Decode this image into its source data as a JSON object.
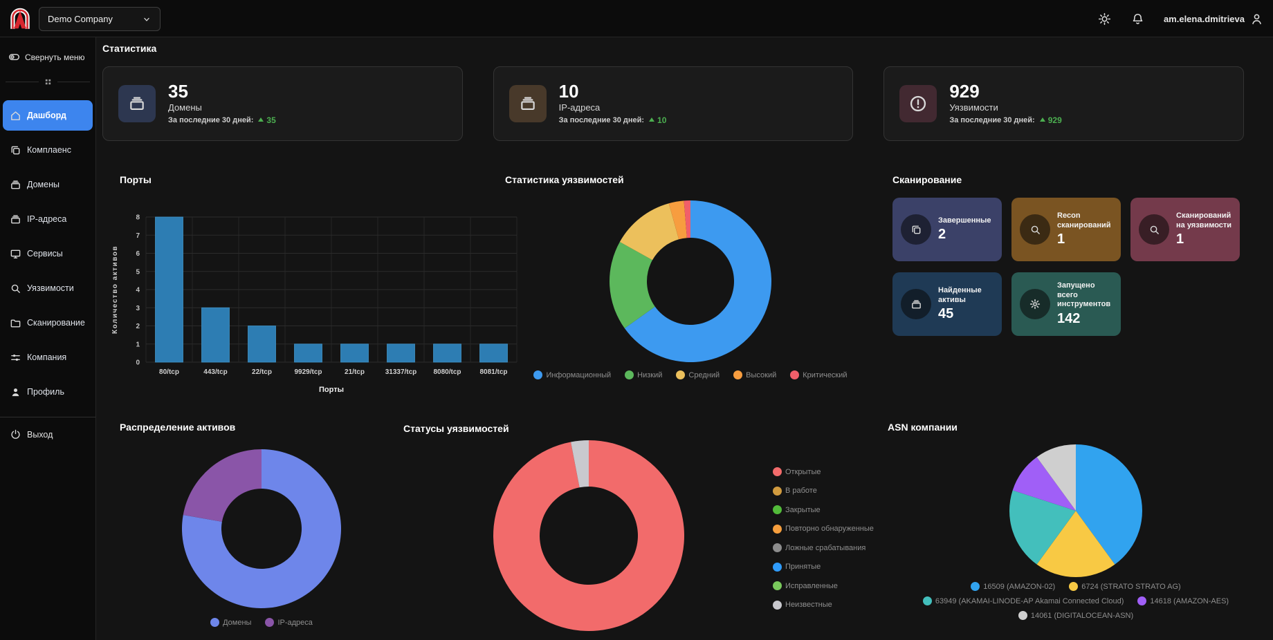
{
  "topbar": {
    "company": "Demo Company",
    "username": "am.elena.dmitrieva"
  },
  "sidebar": {
    "collapse": "Свернуть меню",
    "items": [
      {
        "label": "Дашборд",
        "icon": "home"
      },
      {
        "label": "Комплаенс",
        "icon": "copy"
      },
      {
        "label": "Домены",
        "icon": "archive"
      },
      {
        "label": "IP-адреса",
        "icon": "archive"
      },
      {
        "label": "Сервисы",
        "icon": "monitor"
      },
      {
        "label": "Уязвимости",
        "icon": "search"
      },
      {
        "label": "Сканирование",
        "icon": "folder"
      },
      {
        "label": "Компания",
        "icon": "sliders"
      },
      {
        "label": "Профиль",
        "icon": "user"
      }
    ],
    "logout": "Выход"
  },
  "stats": {
    "title": "Статистика",
    "period_label": "За последние 30 дней:",
    "cards": [
      {
        "value": "35",
        "label": "Домены",
        "delta": "35",
        "icon": "archive",
        "icon_bg": "#2d3750"
      },
      {
        "value": "10",
        "label": "IP-адреса",
        "delta": "10",
        "icon": "archive",
        "icon_bg": "#48392a"
      },
      {
        "value": "929",
        "label": "Уязвимости",
        "delta": "929",
        "icon": "alert",
        "icon_bg": "#422931"
      }
    ]
  },
  "scanning": {
    "title": "Сканирование",
    "cards": [
      {
        "label": "Завершенные",
        "value": "2",
        "bg": "#3b4168",
        "icon": "copy"
      },
      {
        "label": "Recon сканирований",
        "value": "1",
        "bg": "#7a5422",
        "icon": "search"
      },
      {
        "label": "Сканирований на уязвимости",
        "value": "1",
        "bg": "#743a4b",
        "icon": "search"
      },
      {
        "label": "Найденные активы",
        "value": "45",
        "bg": "#1f3a55",
        "icon": "archive"
      },
      {
        "label": "Запущено всего инструментов",
        "value": "142",
        "bg": "#2a5a53",
        "icon": "gear"
      }
    ]
  },
  "colors": {
    "accent": "#3d85ee",
    "trend_green": "#4caf50"
  },
  "chart_data": [
    {
      "type": "bar",
      "title": "Порты",
      "categories": [
        "80/tcp",
        "443/tcp",
        "22/tcp",
        "9929/tcp",
        "21/tcp",
        "31337/tcp",
        "8080/tcp",
        "8081/tcp"
      ],
      "values": [
        8,
        3,
        2,
        1,
        1,
        1,
        1,
        1
      ],
      "xlabel": "Порты",
      "ylabel": "Количество активов",
      "ylim": [
        0,
        8
      ],
      "grid": true,
      "bar_color": "#2d7db3"
    },
    {
      "type": "donut",
      "title": "Статистика уязвимостей",
      "labels": [
        "Информационный",
        "Низкий",
        "Средний",
        "Высокий",
        "Критический"
      ],
      "values": [
        605,
        167,
        117,
        28,
        12
      ],
      "colors": [
        "#3d9af0",
        "#5cb85c",
        "#ecc05c",
        "#f79d3f",
        "#f15f6a"
      ],
      "legend_position": "bottom"
    },
    {
      "type": "donut",
      "title": "Распределение активов",
      "labels": [
        "Домены",
        "IP-адреса"
      ],
      "values": [
        35,
        10
      ],
      "colors": [
        "#6e86ea",
        "#8a55a8"
      ],
      "legend_position": "bottom"
    },
    {
      "type": "donut",
      "title": "Статусы уязвимостей",
      "labels": [
        "Открытые",
        "В работе",
        "Закрытые",
        "Повторно обнаруженные",
        "Ложные срабатывания",
        "Принятые",
        "Исправленные",
        "Неизвестные"
      ],
      "values": [
        901,
        0,
        0,
        0,
        0,
        0,
        0,
        28
      ],
      "colors": [
        "#f26b6b",
        "#d19b3f",
        "#52bb3a",
        "#f69e3d",
        "#8d8d8d",
        "#2f9bfa",
        "#79c95c",
        "#c9c9ce"
      ],
      "legend_position": "right"
    },
    {
      "type": "pie",
      "title": "ASN компании",
      "labels": [
        "16509 (AMAZON-02)",
        "6724 (STRATO STRATO AG)",
        "63949 (AKAMAI-LINODE-AP Akamai Connected Cloud)",
        "14618 (AMAZON-AES)",
        "14061 (DIGITALOCEAN-ASN)"
      ],
      "values": [
        4,
        2,
        2,
        1,
        1
      ],
      "colors": [
        "#31a3ef",
        "#f8c944",
        "#43bfbc",
        "#a05ff7",
        "#cfcfcf"
      ],
      "legend_position": "bottom"
    }
  ]
}
